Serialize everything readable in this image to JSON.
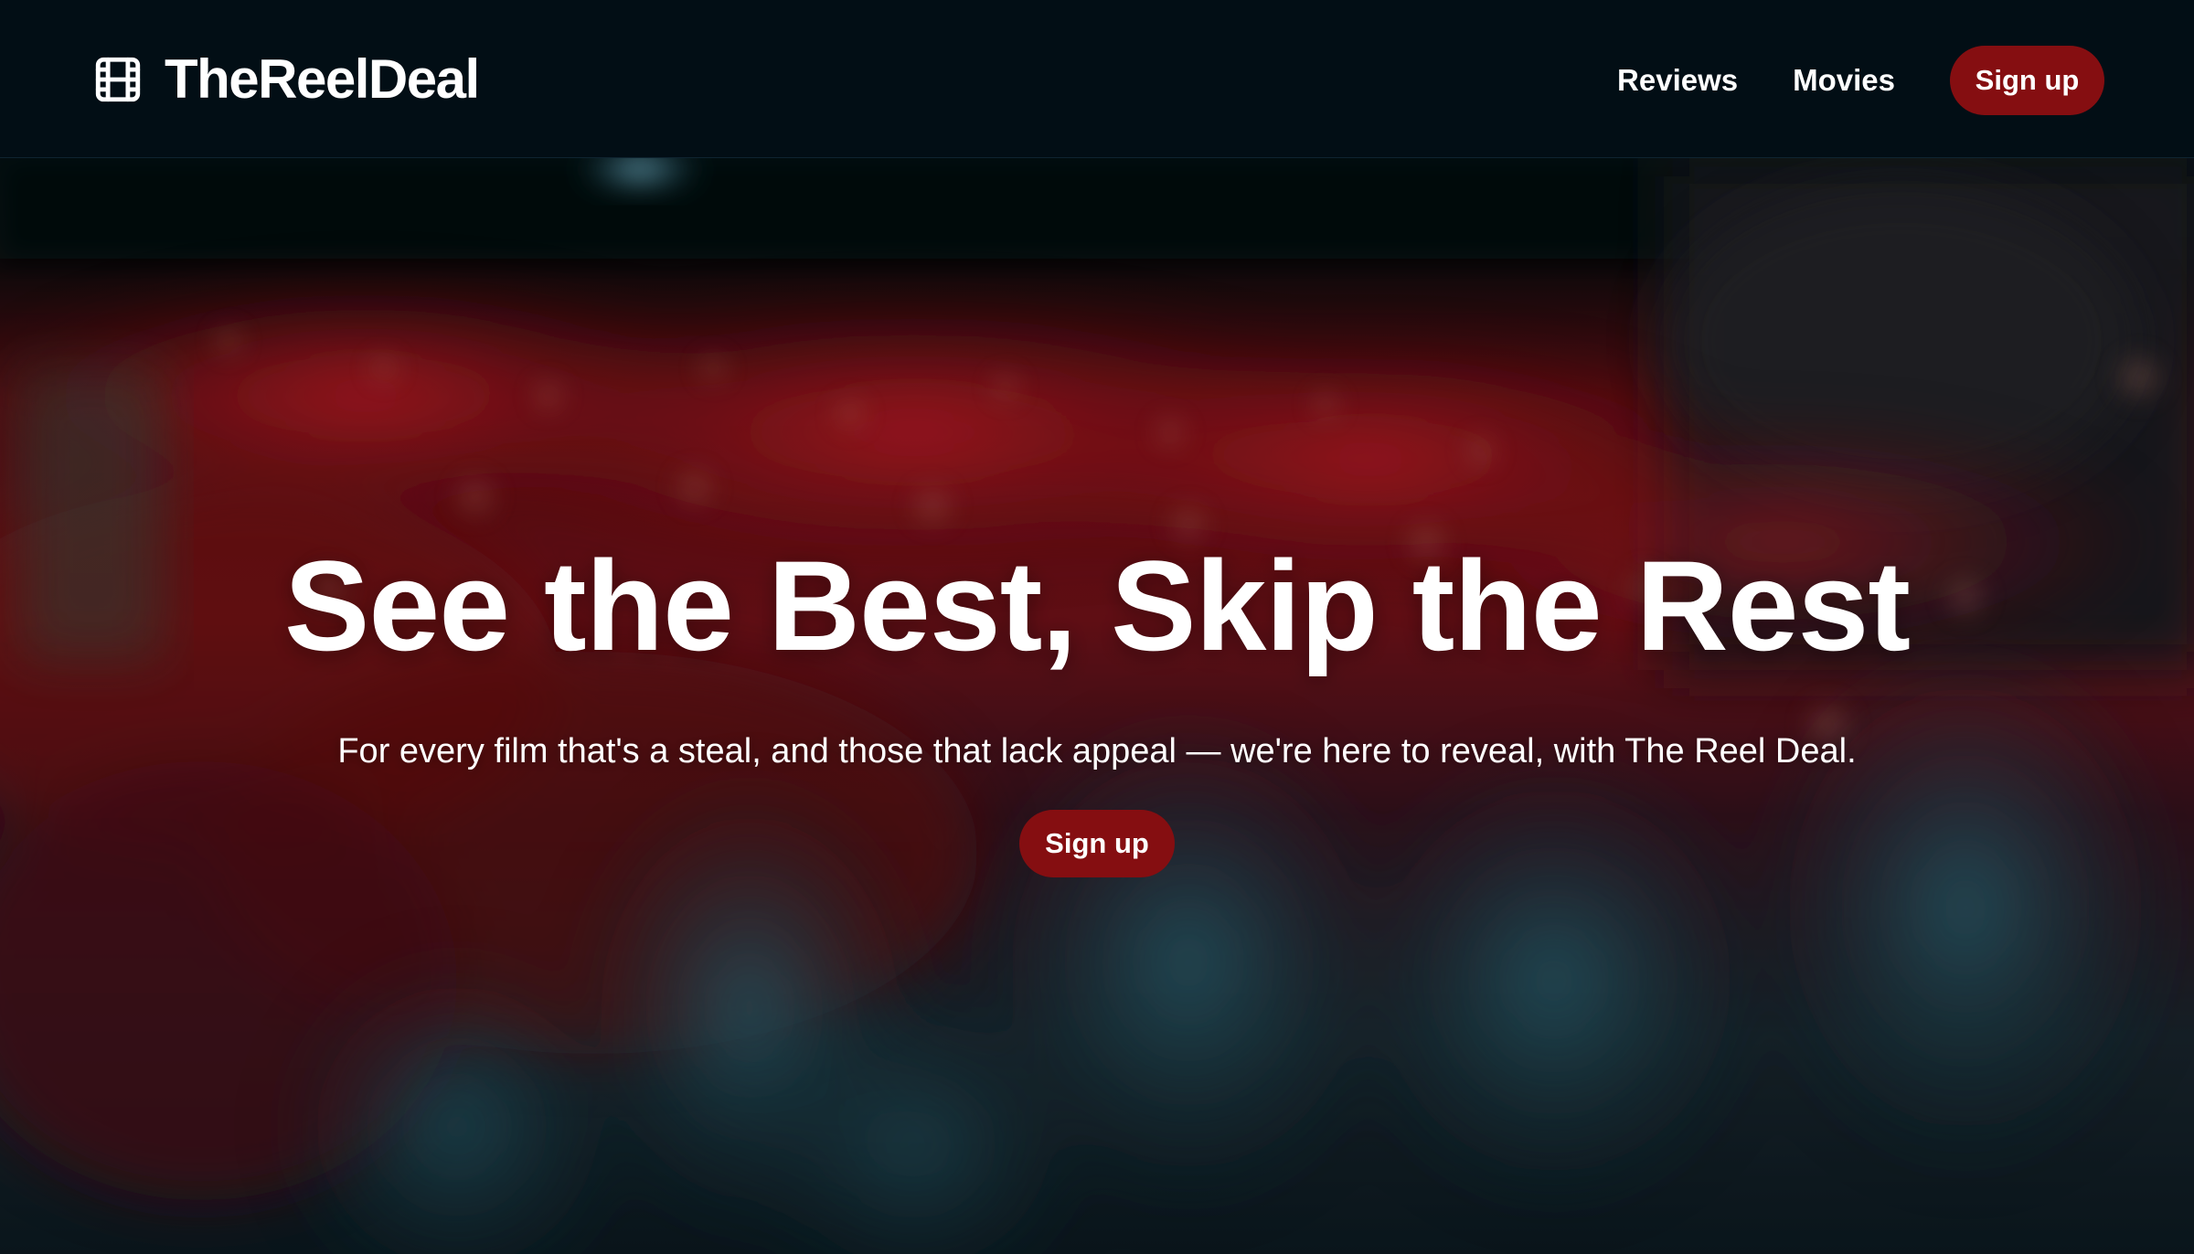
{
  "header": {
    "brand_name": "TheReelDeal",
    "brand_icon": "film-icon",
    "nav": {
      "reviews_label": "Reviews",
      "movies_label": "Movies",
      "signup_label": "Sign up"
    }
  },
  "hero": {
    "title": "See the Best, Skip the Rest",
    "subtitle": "For every film that's a steal, and those that lack appeal — we're here to reveal, with The Reel Deal.",
    "cta_label": "Sign up",
    "background_description_icon": "cinema-audience-photo"
  },
  "colors": {
    "nav_background": "#020e15",
    "accent": "#850e11",
    "text": "#ffffff"
  }
}
